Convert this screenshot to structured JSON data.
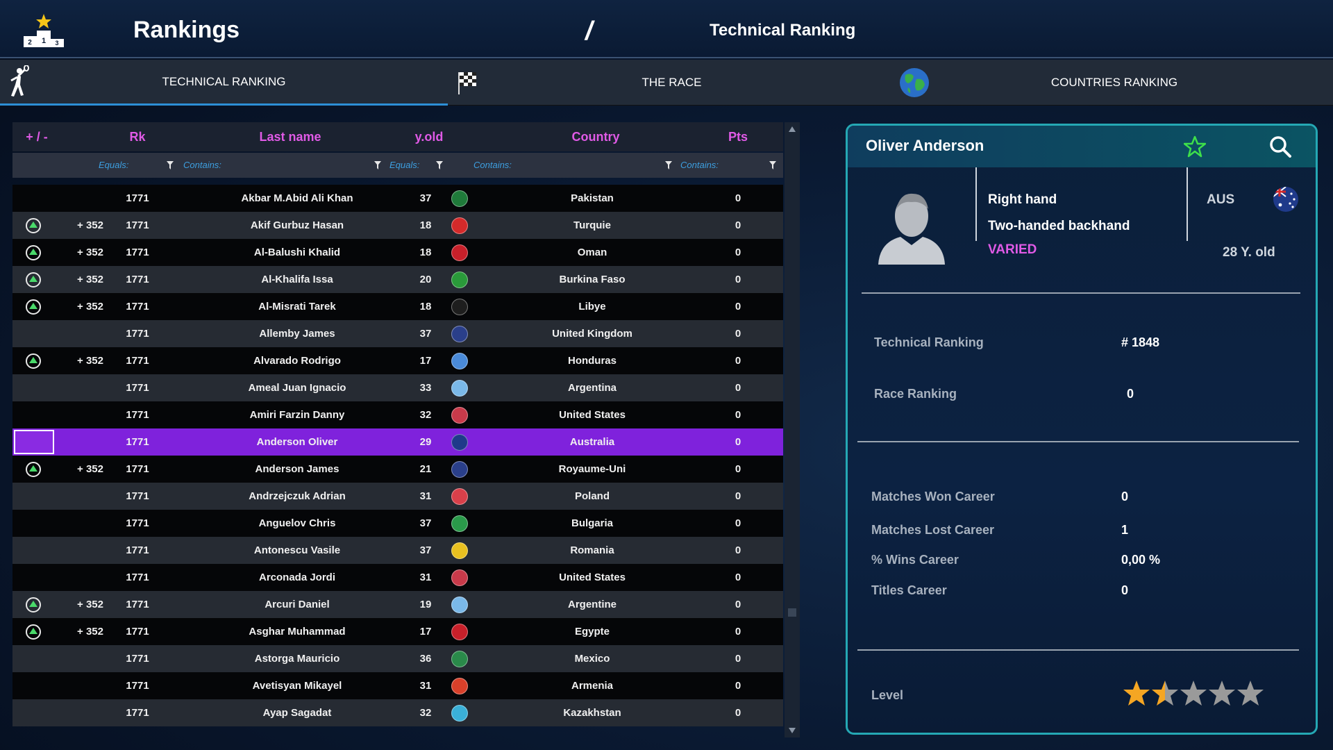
{
  "header": {
    "title": "Rankings",
    "separator": "/",
    "current": "Technical Ranking"
  },
  "tabs": [
    {
      "label": "TECHNICAL RANKING",
      "icon": "tennis-player-icon",
      "active": true
    },
    {
      "label": "THE RACE",
      "icon": "checkered-flag-icon",
      "active": false
    },
    {
      "label": "COUNTRIES RANKING",
      "icon": "globe-icon",
      "active": false
    }
  ],
  "table": {
    "columns": {
      "move": "+ / -",
      "rank": "Rk",
      "last_name": "Last name",
      "age": "y.old",
      "country": "Country",
      "points": "Pts"
    },
    "filters": {
      "rank": "Equals:",
      "last_name": "Contains:",
      "age": "Equals:",
      "country": "Contains:",
      "points": "Contains:"
    },
    "rows": [
      {
        "move": "",
        "up": false,
        "rank": "1771",
        "name": "Akbar M.Abid Ali Khan",
        "age": "37",
        "country": "Pakistan",
        "flag": "#1f7a3a",
        "pts": "0"
      },
      {
        "move": "+ 352",
        "up": true,
        "rank": "1771",
        "name": "Akif Gurbuz Hasan",
        "age": "18",
        "country": "Turquie",
        "flag": "#d42a2a",
        "pts": "0"
      },
      {
        "move": "+ 352",
        "up": true,
        "rank": "1771",
        "name": "Al-Balushi Khalid",
        "age": "18",
        "country": "Oman",
        "flag": "#c8202a",
        "pts": "0"
      },
      {
        "move": "+ 352",
        "up": true,
        "rank": "1771",
        "name": "Al-Khalifa Issa",
        "age": "20",
        "country": "Burkina Faso",
        "flag": "#2a9a3a",
        "pts": "0"
      },
      {
        "move": "+ 352",
        "up": true,
        "rank": "1771",
        "name": "Al-Misrati Tarek",
        "age": "18",
        "country": "Libye",
        "flag": "#1e1e1e",
        "pts": "0"
      },
      {
        "move": "",
        "up": false,
        "rank": "1771",
        "name": "Allemby James",
        "age": "37",
        "country": "United Kingdom",
        "flag": "#2a3f8a",
        "pts": "0"
      },
      {
        "move": "+ 352",
        "up": true,
        "rank": "1771",
        "name": "Alvarado Rodrigo",
        "age": "17",
        "country": "Honduras",
        "flag": "#4a8ad8",
        "pts": "0"
      },
      {
        "move": "",
        "up": false,
        "rank": "1771",
        "name": "Ameal Juan Ignacio",
        "age": "33",
        "country": "Argentina",
        "flag": "#7ab8e8",
        "pts": "0"
      },
      {
        "move": "",
        "up": false,
        "rank": "1771",
        "name": "Amiri Farzin Danny",
        "age": "32",
        "country": "United States",
        "flag": "#c83a4a",
        "pts": "0"
      },
      {
        "move": "",
        "up": false,
        "selected": true,
        "rank": "1771",
        "name": "Anderson Oliver",
        "age": "29",
        "country": "Australia",
        "flag": "#1f3a8a",
        "pts": "0"
      },
      {
        "move": "+ 352",
        "up": true,
        "rank": "1771",
        "name": "Anderson James",
        "age": "21",
        "country": "Royaume-Uni",
        "flag": "#2a3f8a",
        "pts": "0"
      },
      {
        "move": "",
        "up": false,
        "rank": "1771",
        "name": "Andrzejczuk Adrian",
        "age": "31",
        "country": "Poland",
        "flag": "#d8404a",
        "pts": "0"
      },
      {
        "move": "",
        "up": false,
        "rank": "1771",
        "name": "Anguelov Chris",
        "age": "37",
        "country": "Bulgaria",
        "flag": "#2a9a4a",
        "pts": "0"
      },
      {
        "move": "",
        "up": false,
        "rank": "1771",
        "name": "Antonescu Vasile",
        "age": "37",
        "country": "Romania",
        "flag": "#e8c020",
        "pts": "0"
      },
      {
        "move": "",
        "up": false,
        "rank": "1771",
        "name": "Arconada Jordi",
        "age": "31",
        "country": "United States",
        "flag": "#c83a4a",
        "pts": "0"
      },
      {
        "move": "+ 352",
        "up": true,
        "rank": "1771",
        "name": "Arcuri Daniel",
        "age": "19",
        "country": "Argentine",
        "flag": "#7ab8e8",
        "pts": "0"
      },
      {
        "move": "+ 352",
        "up": true,
        "rank": "1771",
        "name": "Asghar Muhammad",
        "age": "17",
        "country": "Egypte",
        "flag": "#c8202a",
        "pts": "0"
      },
      {
        "move": "",
        "up": false,
        "rank": "1771",
        "name": "Astorga Mauricio",
        "age": "36",
        "country": "Mexico",
        "flag": "#2a8a4a",
        "pts": "0"
      },
      {
        "move": "",
        "up": false,
        "rank": "1771",
        "name": "Avetisyan Mikayel",
        "age": "31",
        "country": "Armenia",
        "flag": "#d8402a",
        "pts": "0"
      },
      {
        "move": "",
        "up": false,
        "rank": "1771",
        "name": "Ayap Sagadat",
        "age": "32",
        "country": "Kazakhstan",
        "flag": "#3ab0d8",
        "pts": "0"
      }
    ]
  },
  "player": {
    "name": "Oliver Anderson",
    "hand": "Right hand",
    "backhand": "Two-handed backhand",
    "style": "VARIED",
    "nation": "AUS",
    "age": "28 Y. old",
    "stats": [
      {
        "label": "Technical Ranking",
        "value": "# 1848"
      },
      {
        "label": "Race Ranking",
        "value": "0"
      },
      {
        "label": "Matches Won Career",
        "value": "0"
      },
      {
        "label": "Matches Lost Career",
        "value": "1"
      },
      {
        "label": "% Wins Career",
        "value": "0,00 %"
      },
      {
        "label": "Titles Career",
        "value": "0"
      }
    ],
    "level_label": "Level",
    "level_stars": 1.5,
    "level_max": 5
  },
  "colors": {
    "accent_pink": "#e05ae6",
    "filter_blue": "#3d9fe0",
    "selected_row": "#7f22dc",
    "panel_border": "#25a8b4",
    "up_arrow": "#4ad96a",
    "star_gold": "#f5a623",
    "star_gray": "#9a9a9a"
  }
}
